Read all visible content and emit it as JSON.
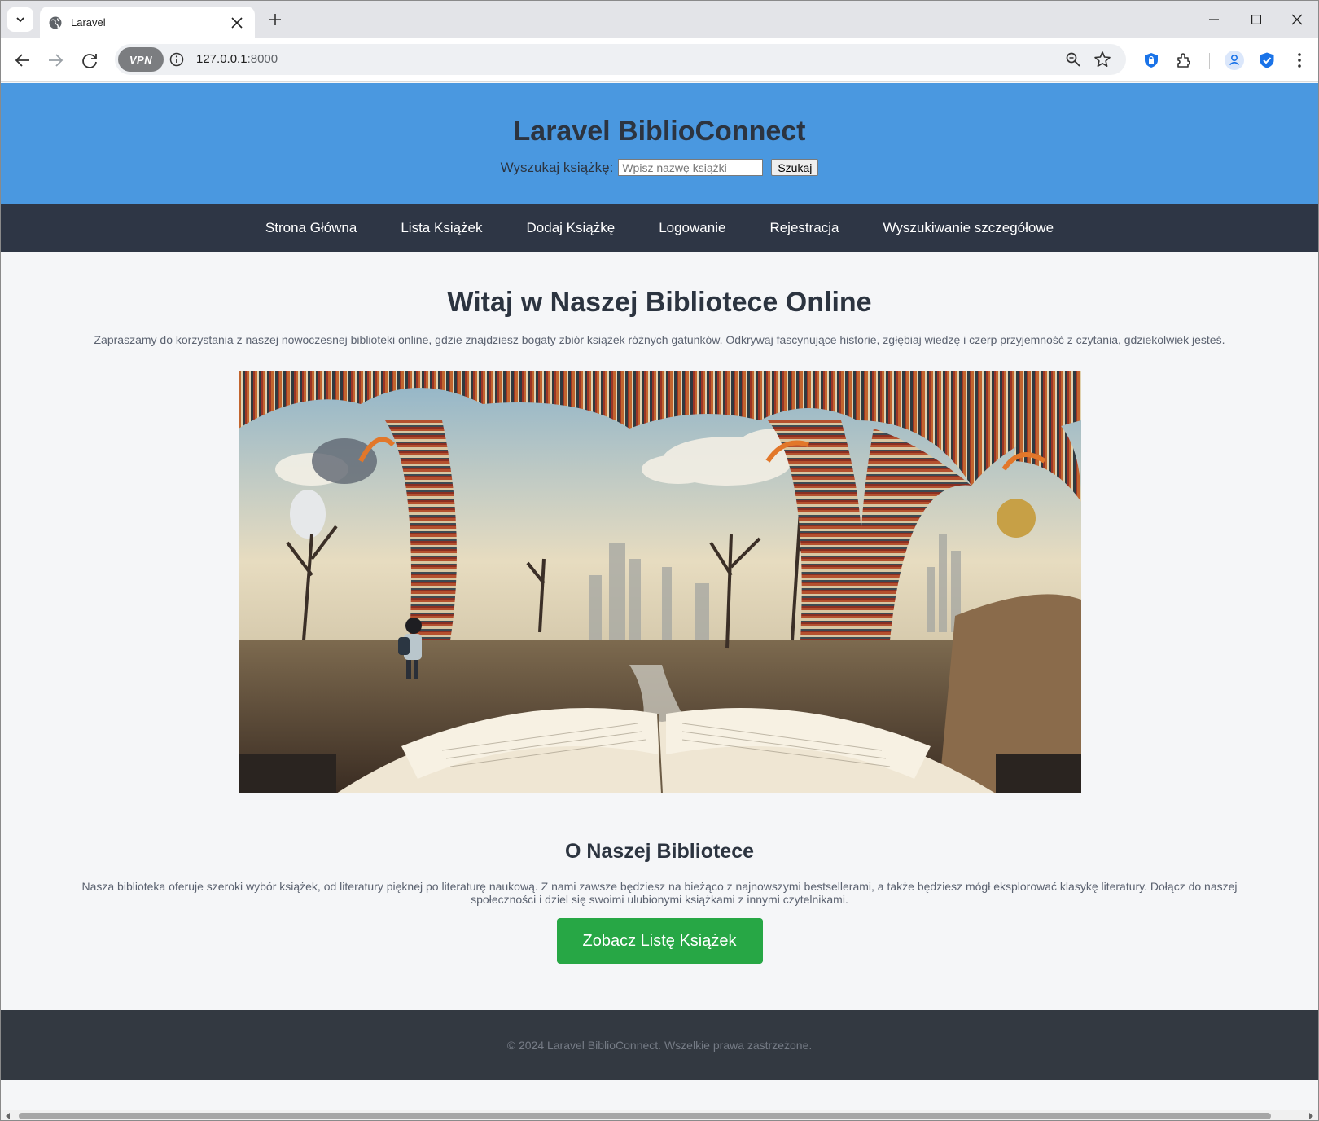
{
  "browser": {
    "tab_title": "Laravel",
    "url_host": "127.0.0.1",
    "url_port": ":8000",
    "vpn_label": "VPN",
    "icons": [
      "tab-search-icon",
      "globe-icon",
      "close-icon",
      "plus-icon",
      "minimize-icon",
      "maximize-icon",
      "back-arrow-icon",
      "forward-arrow-icon",
      "reload-icon",
      "site-info-icon",
      "zoom-icon",
      "star-icon",
      "shield-lock-icon",
      "extensions-icon",
      "profile-icon",
      "bitwarden-shield-icon",
      "kebab-menu-icon"
    ]
  },
  "header": {
    "title": "Laravel BiblioConnect",
    "search_label": "Wyszukaj książkę:",
    "search_placeholder": "Wpisz nazwę książki",
    "search_button": "Szukaj"
  },
  "nav": {
    "items": [
      {
        "label": "Strona Główna"
      },
      {
        "label": "Lista Książek"
      },
      {
        "label": "Dodaj Książkę"
      },
      {
        "label": "Logowanie"
      },
      {
        "label": "Rejestracja"
      },
      {
        "label": "Wyszukiwanie szczegółowe"
      }
    ]
  },
  "main": {
    "welcome_title": "Witaj w Naszej Bibliotece Online",
    "welcome_text": "Zapraszamy do korzystania z naszej nowoczesnej biblioteki online, gdzie znajdziesz bogaty zbiór książek różnych gatunków. Odkrywaj fascynujące historie, zgłębiaj wiedzę i czerp przyjemność z czytania, gdziekolwiek jesteś.",
    "about_title": "O Naszej Bibliotece",
    "about_text": "Nasza biblioteka oferuje szeroki wybór książek, od literatury pięknej po literaturę naukową. Z nami zawsze będziesz na bieżąco z najnowszymi bestsellerami, a także będziesz mógł eksplorować klasykę literatury. Dołącz do naszej społeczności i dziel się swoimi ulubionymi książkami z innymi czytelnikami.",
    "cta_label": "Zobacz Listę Książek"
  },
  "footer": {
    "text": "© 2024 Laravel BiblioConnect. Wszelkie prawa zastrzeżone."
  },
  "colors": {
    "header_bg": "#4a98e0",
    "nav_bg": "#2e3645",
    "cta_bg": "#27a745",
    "footer_bg": "#333941"
  }
}
